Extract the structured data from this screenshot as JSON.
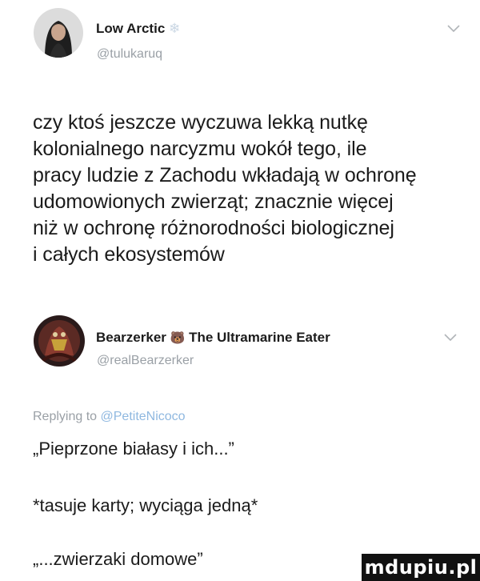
{
  "tweet1": {
    "name": "Low Arctic",
    "name_emoji": "❄",
    "handle": "@tulukaruq",
    "text": "czy ktoś jeszcze wyczuwa lekką nutkę\nkolonialnego narcyzmu wokół tego, ile\npracy ludzie z Zachodu wkładają w ochronę\nudomowionych zwierząt; znacznie więcej\nniż w ochronę różnorodności biologicznej\ni całych ekosystemów"
  },
  "tweet2": {
    "name": "Bearzerker",
    "name_emoji": "🐻",
    "name_suffix": "The Ultramarine Eater",
    "handle": "@realBearzerker",
    "replying_prefix": "Replying to",
    "replying_mention": "@PetiteNicoco",
    "lines": [
      "„Pieprzone białasy i ich...”",
      "*tasuje karty; wyciąga jedną*",
      "„...zwierzaki domowe”"
    ]
  },
  "watermark": "mdupiu.pl"
}
